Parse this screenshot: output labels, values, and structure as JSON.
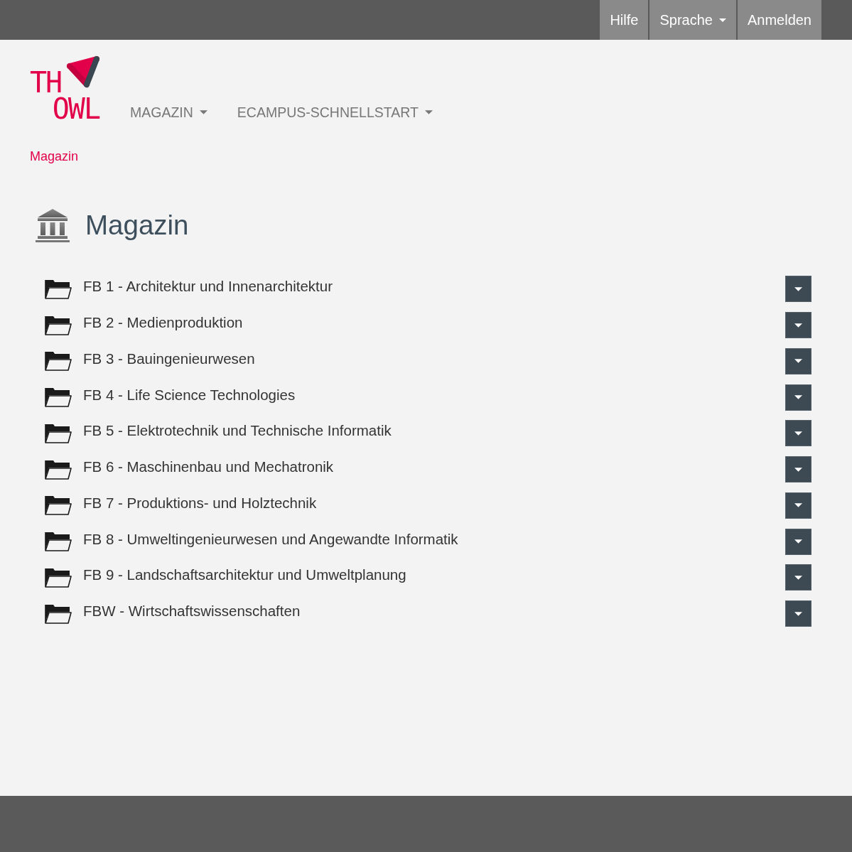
{
  "top_bar": {
    "items": [
      {
        "label": "Hilfe",
        "kind": "link"
      },
      {
        "label": "Sprache",
        "kind": "dropdown"
      },
      {
        "label": "Anmelden",
        "kind": "link"
      }
    ]
  },
  "logo": {
    "line_1": "TH",
    "line_2": "OWL"
  },
  "main_nav": [
    {
      "label": "MAGAZIN"
    },
    {
      "label": "ECAMPUS-SCHNELLSTART"
    }
  ],
  "breadcrumb": [
    "Magazin"
  ],
  "page_title": "Magazin",
  "categories": [
    {
      "label": "FB 1 - Architektur und Innenarchitektur"
    },
    {
      "label": "FB 2 - Medienproduktion"
    },
    {
      "label": "FB 3 - Bauingenieurwesen"
    },
    {
      "label": "FB 4 - Life Science Technologies"
    },
    {
      "label": "FB 5 - Elektrotechnik und Technische Informatik"
    },
    {
      "label": "FB 6 - Maschinenbau und Mechatronik"
    },
    {
      "label": "FB 7 - Produktions- und Holztechnik"
    },
    {
      "label": "FB 8 - Umweltingenieurwesen und Angewandte Informatik"
    },
    {
      "label": "FB 9 - Landschaftsarchitektur und Umweltplanung"
    },
    {
      "label": "FBW - Wirtschaftswissenschaften"
    }
  ]
}
